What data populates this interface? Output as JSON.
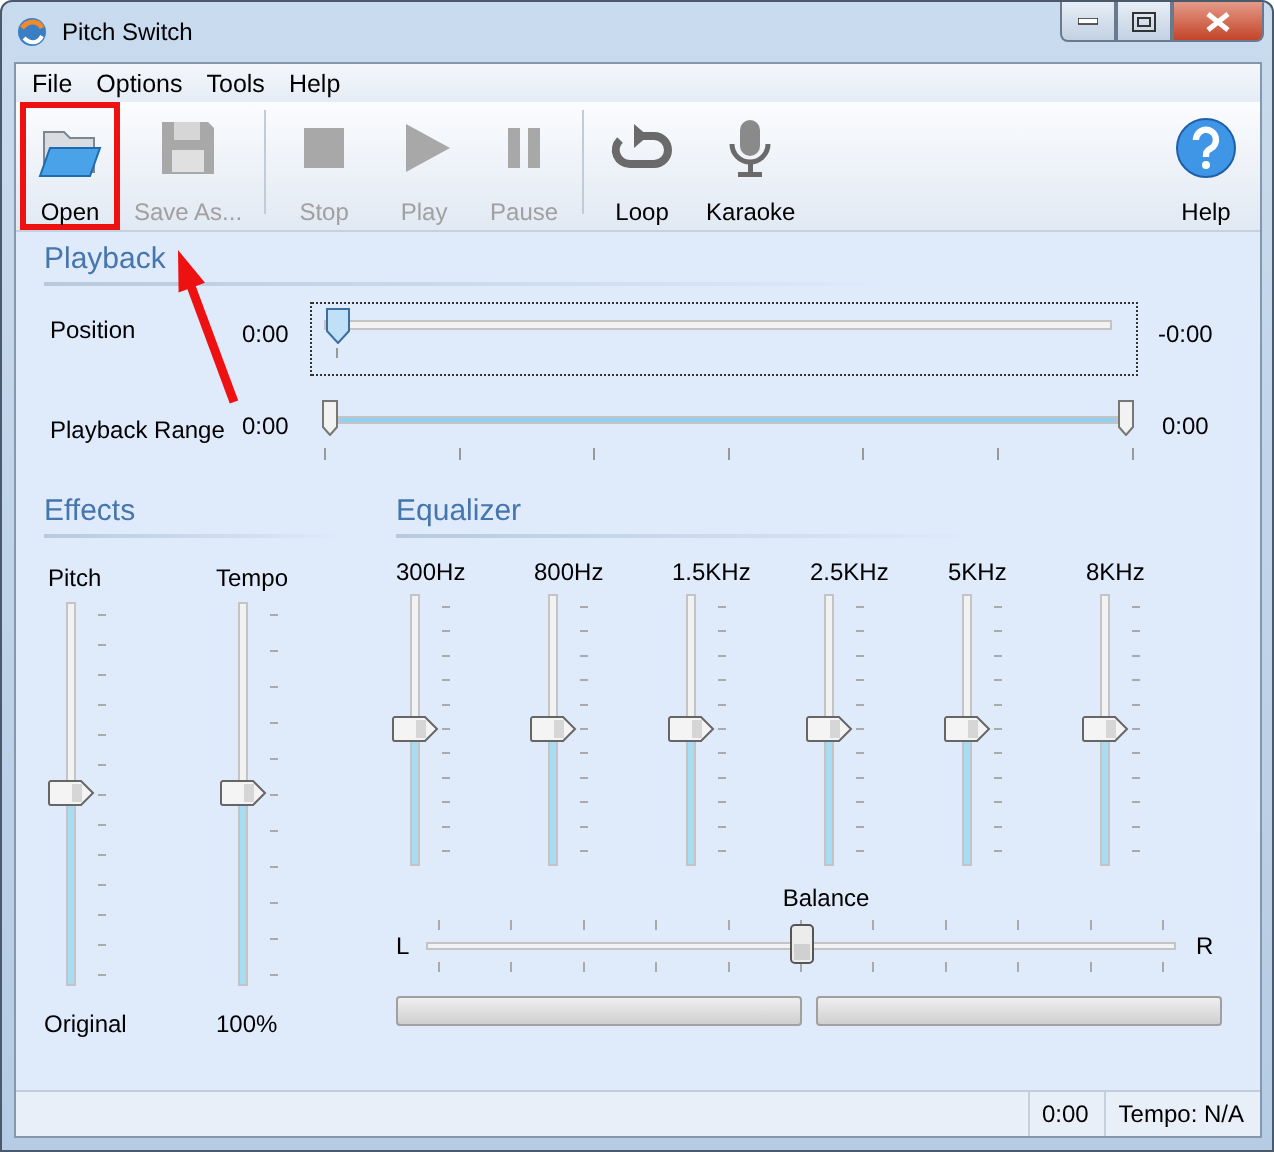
{
  "window": {
    "title": "Pitch Switch"
  },
  "menu": [
    "File",
    "Options",
    "Tools",
    "Help"
  ],
  "toolbar": [
    {
      "kind": "open",
      "label": "Open",
      "disabled": false,
      "highlighted": true
    },
    {
      "kind": "save",
      "label": "Save As...",
      "disabled": true,
      "highlighted": false
    },
    {
      "kind": "separator"
    },
    {
      "kind": "stop",
      "label": "Stop",
      "disabled": true,
      "highlighted": false
    },
    {
      "kind": "play",
      "label": "Play",
      "disabled": true,
      "highlighted": false
    },
    {
      "kind": "pause",
      "label": "Pause",
      "disabled": true,
      "highlighted": false
    },
    {
      "kind": "separator"
    },
    {
      "kind": "loop",
      "label": "Loop",
      "disabled": false,
      "highlighted": false
    },
    {
      "kind": "karaoke",
      "label": "Karaoke",
      "disabled": false,
      "highlighted": false
    },
    {
      "kind": "spacer"
    },
    {
      "kind": "help",
      "label": "Help",
      "disabled": false,
      "highlighted": false
    }
  ],
  "playback": {
    "title": "Playback",
    "position": {
      "label": "Position",
      "start": "0:00",
      "end": "-0:00",
      "level": 0,
      "focused": true
    },
    "range": {
      "label": "Playback Range",
      "start": "0:00",
      "end": "0:00",
      "thumbs": [
        {
          "level": 0
        },
        {
          "level": 1
        }
      ]
    }
  },
  "effects": {
    "title": "Effects",
    "sliders": [
      {
        "label": "Pitch",
        "level": 0.5,
        "reading": "Original"
      },
      {
        "label": "Tempo",
        "level": 0.5,
        "reading": "100%"
      }
    ]
  },
  "equalizer": {
    "title": "Equalizer",
    "bands": [
      {
        "label": "300Hz",
        "level": 0.5
      },
      {
        "label": "800Hz",
        "level": 0.5
      },
      {
        "label": "1.5KHz",
        "level": 0.5
      },
      {
        "label": "2.5KHz",
        "level": 0.5
      },
      {
        "label": "5KHz",
        "level": 0.5
      },
      {
        "label": "8KHz",
        "level": 0.5
      }
    ],
    "balance": {
      "label": "Balance",
      "left": "L",
      "right": "R",
      "level": 0.5
    },
    "meters": [
      {
        "level": 0
      },
      {
        "level": 0
      }
    ]
  },
  "status_bar": [
    "0:00",
    "Tempo: N/A"
  ]
}
